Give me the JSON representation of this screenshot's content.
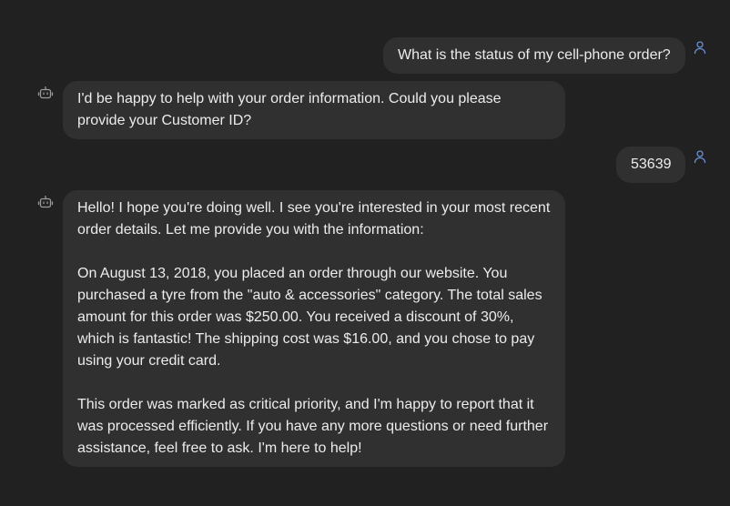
{
  "messages": [
    {
      "role": "user",
      "icon": "user-icon",
      "text": "What is the status of my cell-phone order?"
    },
    {
      "role": "assistant",
      "icon": "bot-icon",
      "text": "I'd be happy to help with your order information. Could you please\nprovide your Customer ID?"
    },
    {
      "role": "user",
      "icon": "user-icon",
      "text": "53639"
    },
    {
      "role": "assistant",
      "icon": "bot-icon",
      "paragraphs": [
        "Hello! I hope you're doing well. I see you're interested in your most recent\norder details. Let me provide you with the information:",
        "On August 13, 2018, you placed an order through our website. You\npurchased a tyre from the \"auto & accessories\" category. The total sales\namount for this order was $250.00. You received a discount of 30%,\nwhich is fantastic! The shipping cost was $16.00, and you chose to pay\nusing your credit card.",
        "This order was marked as critical priority, and I'm happy to report that it\nwas processed efficiently. If you have any more questions or need further\nassistance, feel free to ask. I'm here to help!"
      ]
    }
  ],
  "colors": {
    "background": "#212121",
    "bubble": "#303030",
    "text": "#ececec",
    "user_icon": "#6b8fd6",
    "bot_icon": "#9a9a9a"
  }
}
